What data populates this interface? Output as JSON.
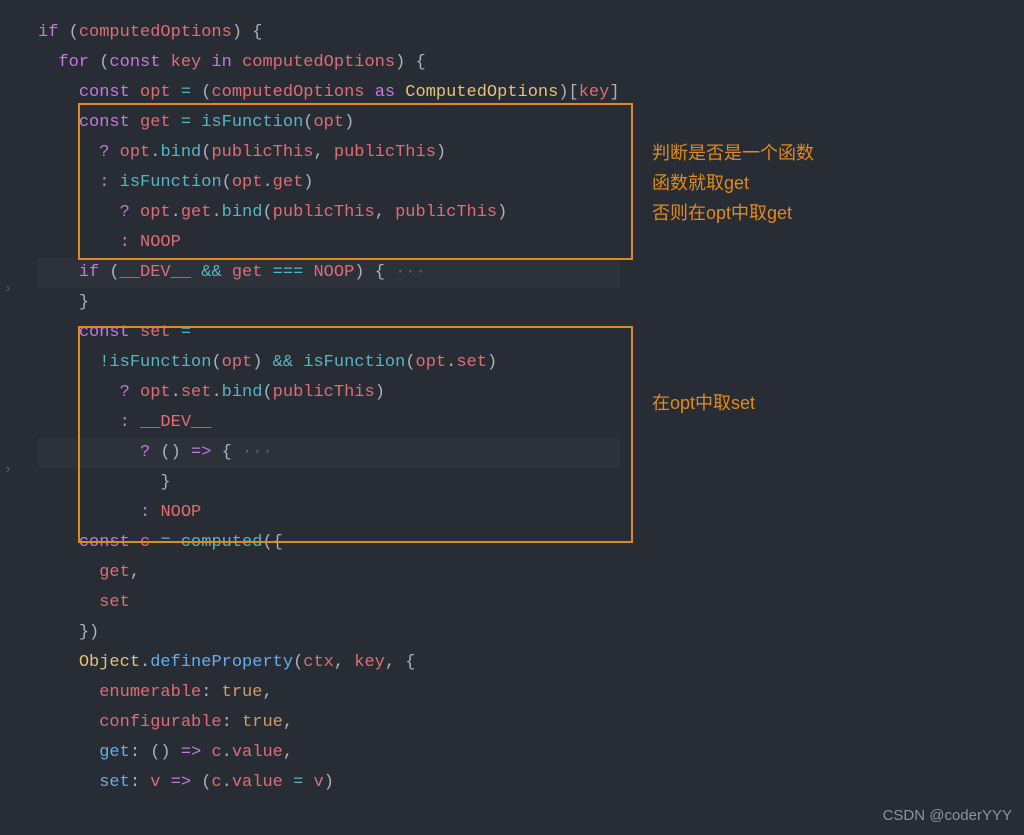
{
  "code": {
    "l0_if": "if",
    "l0_paren_o": " (",
    "l0_var": "computedOptions",
    "l0_paren_c": ") {",
    "l1_for": "for",
    "l1_paren_o": " (",
    "l1_const": "const",
    "l1_sp1": " ",
    "l1_key": "key",
    "l1_sp2": " ",
    "l1_in": "in",
    "l1_sp3": " ",
    "l1_var": "computedOptions",
    "l1_paren_c": ") {",
    "l2_const": "const",
    "l2_sp1": " ",
    "l2_opt": "opt",
    "l2_sp2": " ",
    "l2_eq": "=",
    "l2_sp3": " (",
    "l2_co": "computedOptions",
    "l2_sp4": " ",
    "l2_as": "as",
    "l2_sp5": " ",
    "l2_type": "ComputedOptions",
    "l2_br": ")[",
    "l2_key": "key",
    "l2_br2": "]",
    "l3_const": "const",
    "l3_sp1": " ",
    "l3_get": "get",
    "l3_sp2": " ",
    "l3_eq": "=",
    "l3_sp3": " ",
    "l3_fn": "isFunction",
    "l3_po": "(",
    "l3_opt": "opt",
    "l3_pc": ")",
    "l4_q": "?",
    "l4_sp": " ",
    "l4_opt": "opt",
    "l4_dot": ".",
    "l4_bind": "bind",
    "l4_po": "(",
    "l4_p1": "publicThis",
    "l4_cm": ", ",
    "l4_p2": "publicThis",
    "l4_pc": ")",
    "l5_c": ":",
    "l5_sp": " ",
    "l5_fn": "isFunction",
    "l5_po": "(",
    "l5_opt": "opt",
    "l5_dot": ".",
    "l5_get": "get",
    "l5_pc": ")",
    "l6_q": "?",
    "l6_sp": " ",
    "l6_opt": "opt",
    "l6_d1": ".",
    "l6_get": "get",
    "l6_d2": ".",
    "l6_bind": "bind",
    "l6_po": "(",
    "l6_p1": "publicThis",
    "l6_cm": ", ",
    "l6_p2": "publicThis",
    "l6_pc": ")",
    "l7_c": ":",
    "l7_sp": " ",
    "l7_noop": "NOOP",
    "l8_if": "if",
    "l8_po": " (",
    "l8_dev": "__DEV__",
    "l8_sp1": " ",
    "l8_and": "&&",
    "l8_sp2": " ",
    "l8_get": "get",
    "l8_sp3": " ",
    "l8_eq": "===",
    "l8_sp4": " ",
    "l8_noop": "NOOP",
    "l8_pc": ") {",
    "l8_dots": " ···",
    "l9_brace": "}",
    "l10_const": "const",
    "l10_sp1": " ",
    "l10_set": "set",
    "l10_sp2": " ",
    "l10_eq": "=",
    "l11_bang": "!",
    "l11_fn": "isFunction",
    "l11_po": "(",
    "l11_opt": "opt",
    "l11_pc": ")",
    "l11_sp": " ",
    "l11_and": "&&",
    "l11_sp2": " ",
    "l11_fn2": "isFunction",
    "l11_po2": "(",
    "l11_opt2": "opt",
    "l11_dot": ".",
    "l11_set": "set",
    "l11_pc2": ")",
    "l12_q": "?",
    "l12_sp": " ",
    "l12_opt": "opt",
    "l12_d1": ".",
    "l12_set": "set",
    "l12_d2": ".",
    "l12_bind": "bind",
    "l12_po": "(",
    "l12_p": "publicThis",
    "l12_pc": ")",
    "l13_c": ":",
    "l13_sp": " ",
    "l13_dev": "__DEV__",
    "l14_q": "?",
    "l14_po": " ()",
    "l14_sp": " ",
    "l14_ar": "=>",
    "l14_br": " {",
    "l14_dots": " ···",
    "l15_brace": "}",
    "l16_c": ":",
    "l16_sp": " ",
    "l16_noop": "NOOP",
    "l17_const": "const",
    "l17_sp1": " ",
    "l17_c": "c",
    "l17_sp2": " ",
    "l17_eq": "=",
    "l17_sp3": " ",
    "l17_fn": "computed",
    "l17_po": "({",
    "l18_get": "get",
    "l18_cm": ",",
    "l19_set": "set",
    "l20_pc": "})",
    "l21_obj": "Object",
    "l21_dot": ".",
    "l21_fn": "defineProperty",
    "l21_po": "(",
    "l21_ctx": "ctx",
    "l21_c1": ", ",
    "l21_key": "key",
    "l21_c2": ", {",
    "l22_enum": "enumerable",
    "l22_c": ": ",
    "l22_v": "true",
    "l22_cm": ",",
    "l23_conf": "configurable",
    "l23_c": ": ",
    "l23_v": "true",
    "l23_cm": ",",
    "l24_get": "get",
    "l24_c": ": () ",
    "l24_ar": "=>",
    "l24_sp": " ",
    "l24_cc": "c",
    "l24_d": ".",
    "l24_val": "value",
    "l24_cm": ",",
    "l25_set": "set",
    "l25_c": ": ",
    "l25_v": "v",
    "l25_sp": " ",
    "l25_ar": "=>",
    "l25_po": " (",
    "l25_cc": "c",
    "l25_d": ".",
    "l25_val": "value",
    "l25_sp2": " ",
    "l25_eq": "=",
    "l25_sp3": " ",
    "l25_v2": "v",
    "l25_pc": ")"
  },
  "annotations": {
    "a1_l1": "判断是否是一个函数",
    "a1_l2": "函数就取get",
    "a1_l3": "否则在opt中取get",
    "a2": "在opt中取set"
  },
  "watermark": "CSDN @coderYYY"
}
